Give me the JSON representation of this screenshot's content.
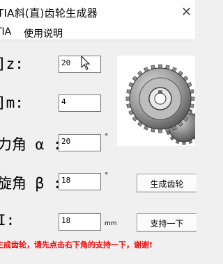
{
  "window": {
    "title": "TIA斜(直)齿轮生成器",
    "close_glyph": "✕"
  },
  "menu": {
    "items": [
      "TIA",
      "使用说明"
    ]
  },
  "fields": [
    {
      "label": "]z:",
      "value": "20"
    },
    {
      "label": "]m:",
      "value": "4"
    },
    {
      "label": "力角 α :",
      "value": "20",
      "unit": "°"
    },
    {
      "label": "旋角 β :",
      "value": "18",
      "unit": "°"
    },
    {
      "label": "I:",
      "value": "18",
      "unit": "mm"
    }
  ],
  "buttons": {
    "generate": "生成齿轮",
    "support": "支持一下"
  },
  "note": "生成齿轮，请先点击右下角的支持一下，谢谢!",
  "gear_image": {
    "icon": "gear-image"
  }
}
